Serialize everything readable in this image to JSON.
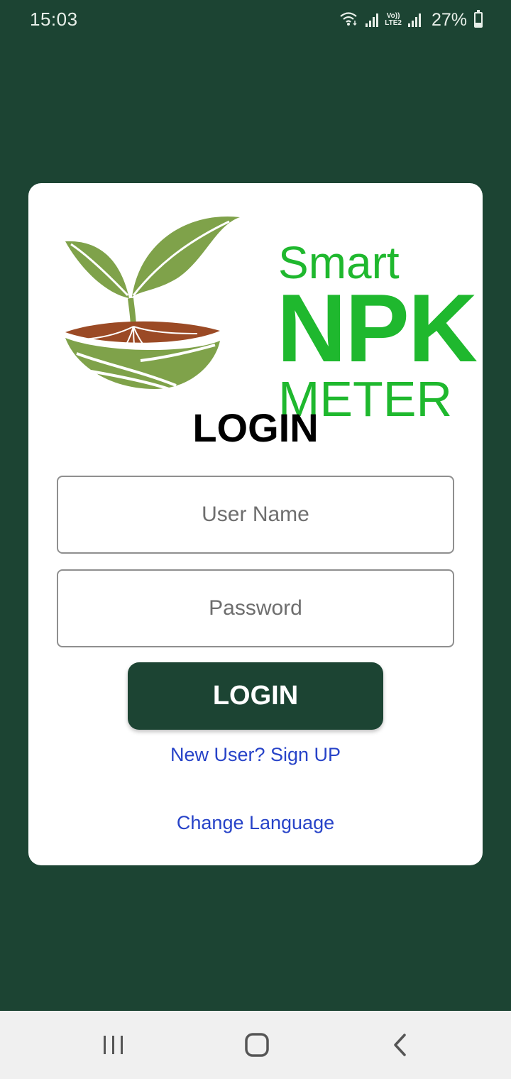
{
  "status_bar": {
    "time": "15:03",
    "volte_line1": "Vo))",
    "volte_line2": "LTE2",
    "battery_percent": "27%",
    "battery_level": 0.27
  },
  "logo": {
    "line1": "Smart",
    "line2": "NPK",
    "line3": "METER"
  },
  "login": {
    "heading": "LOGIN",
    "username_placeholder": "User Name",
    "username_value": "",
    "password_placeholder": "Password",
    "password_value": "",
    "button_label": "LOGIN",
    "signup_link": "New User? Sign UP",
    "language_link": "Change Language"
  },
  "nav_bar": {
    "recents_icon": "recents-icon",
    "home_icon": "home-icon",
    "back_icon": "back-icon"
  },
  "colors": {
    "background": "#1c4433",
    "card": "#ffffff",
    "logo_green": "#1fb82e",
    "leaf_green": "#7fa24a",
    "soil_brown": "#9b4a25",
    "link_blue": "#2743c8",
    "button": "#1c4433"
  }
}
